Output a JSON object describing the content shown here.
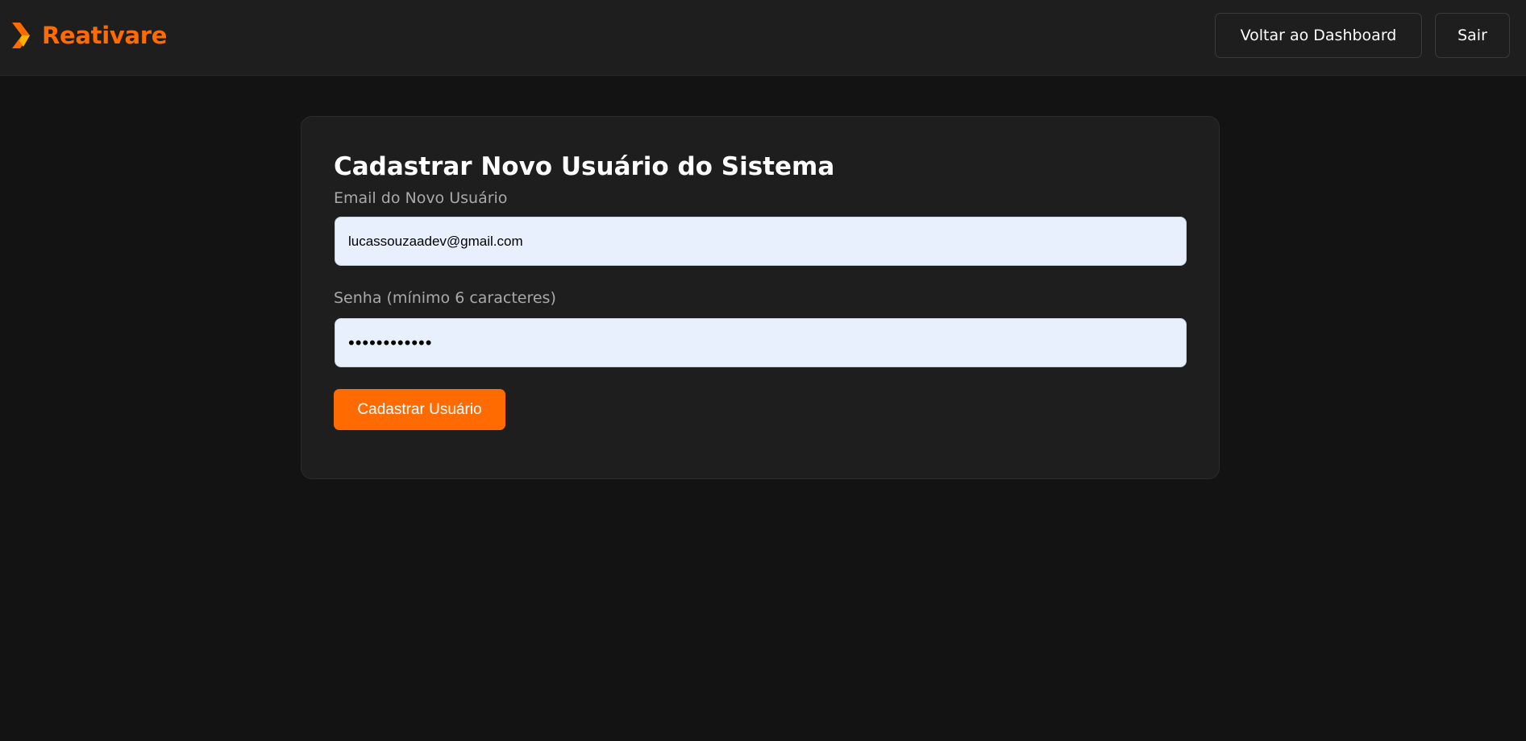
{
  "header": {
    "brand_name": "Reativare",
    "brand_icon": "chevron-right-logo-icon",
    "dashboard_label": "Voltar ao Dashboard",
    "logout_label": "Sair"
  },
  "form": {
    "title": "Cadastrar Novo Usuário do Sistema",
    "email_label": "Email do Novo Usuário",
    "email_value": "lucassouzaadev@gmail.com",
    "password_label": "Senha (mínimo 6 caracteres)",
    "password_value": "••••••••••••",
    "submit_label": "Cadastrar Usuário"
  },
  "colors": {
    "accent": "#ff6b00",
    "background": "#131313",
    "surface": "#1e1e1e",
    "input_background": "#e8f0fe"
  }
}
